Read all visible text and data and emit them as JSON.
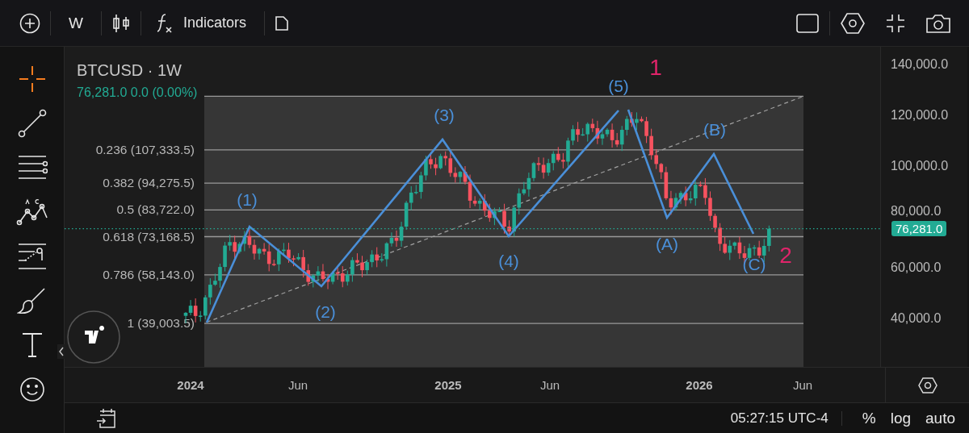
{
  "toolbar": {
    "interval": "W",
    "indicators_label": "Indicators"
  },
  "tools": [
    {
      "kind": "crosshair",
      "selected": true
    },
    {
      "kind": "trendline",
      "selected": false
    },
    {
      "kind": "fib",
      "selected": false
    },
    {
      "kind": "pattern",
      "selected": false
    },
    {
      "kind": "forecast",
      "selected": false
    },
    {
      "kind": "brush",
      "selected": false
    },
    {
      "kind": "text",
      "selected": false
    },
    {
      "kind": "emoji",
      "selected": false
    }
  ],
  "chart": {
    "symbol_title": "BTCUSD · 1W",
    "quote": "76,281.0 0.0 (0.00%)",
    "fib_levels": [
      {
        "label": "0.236 (107,333.5)"
      },
      {
        "label": "0.382 (94,275.5)"
      },
      {
        "label": "0.5 (83,722.0)"
      },
      {
        "label": "0.618 (73,168.5)"
      },
      {
        "label": "0.786 (58,143.0)"
      },
      {
        "label": "1 (39,003.5)"
      }
    ],
    "wave_labels": [
      {
        "label": "(1)",
        "kind": "wave"
      },
      {
        "label": "(2)",
        "kind": "wave"
      },
      {
        "label": "(3)",
        "kind": "wave"
      },
      {
        "label": "(4)",
        "kind": "wave"
      },
      {
        "label": "(5)",
        "kind": "wave"
      },
      {
        "label": "1",
        "kind": "degree"
      },
      {
        "label": "(B)",
        "kind": "wave"
      },
      {
        "label": "(A)",
        "kind": "wave"
      },
      {
        "label": "2",
        "kind": "degree"
      },
      {
        "label": "(C)",
        "kind": "wave"
      }
    ],
    "price_axis": [
      "140,000.0",
      "120,000.0",
      "100,000.0",
      "80,000.0",
      "60,000.0",
      "40,000.0"
    ],
    "last_price": "76,281.0"
  },
  "time_axis": [
    {
      "label": "2024",
      "kind": "year"
    },
    {
      "label": "Jun",
      "kind": "month"
    },
    {
      "label": "2025",
      "kind": "year"
    },
    {
      "label": "Jun",
      "kind": "month"
    },
    {
      "label": "2026",
      "kind": "year"
    },
    {
      "label": "Jun",
      "kind": "month"
    }
  ],
  "status_bar": {
    "time": "05:27:15 UTC-4",
    "buttons": [
      "%",
      "log",
      "auto"
    ]
  }
}
